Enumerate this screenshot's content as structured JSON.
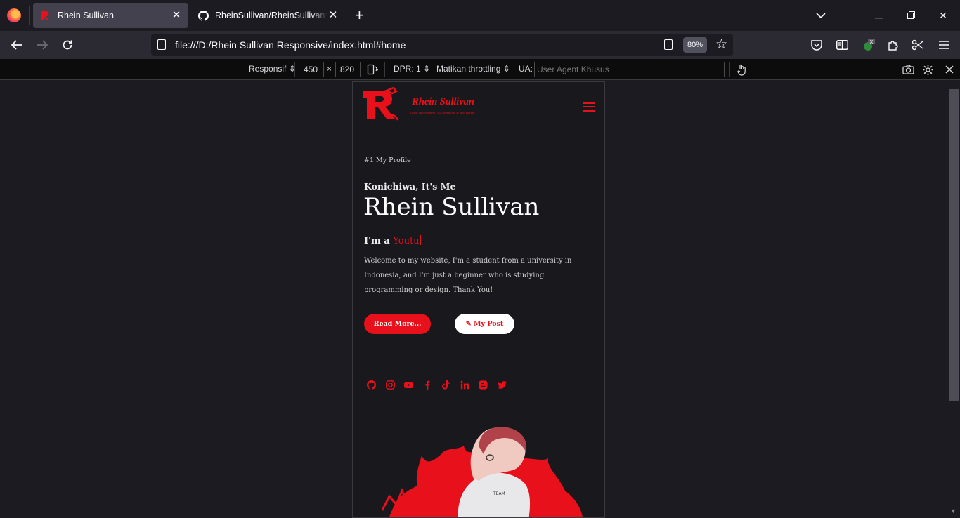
{
  "browser": {
    "tabs": [
      {
        "title": "Rhein Sullivan",
        "active": true
      },
      {
        "title": "RheinSullivan/RheinSullivan: Be",
        "active": false
      }
    ],
    "url": "file:///D:/Rhein Sullivan Responsive/index.html#home",
    "zoom": "80%"
  },
  "responsive_toolbar": {
    "device": "Responsif",
    "width": "450",
    "times": "×",
    "height": "820",
    "dpr": "DPR: 1",
    "throttling": "Matikan throttling",
    "ua_label": "UA:",
    "ua_placeholder": "User Agent Khusus"
  },
  "site": {
    "logo_title": "Rhein Sullivan",
    "logo_subtitle": "Game Development, 3D Animation, & Web Design",
    "profile_tag": "#1 My Profile",
    "greeting": "Konichiwa, It's Me",
    "name": "Rhein Sullivan",
    "role_prefix": "I'm a",
    "role_typed": "Youtu",
    "intro": "Welcome to my website, I'm a student from a university in Indonesia, and I'm just a beginner who is studying programming or design. Thank You!",
    "btn_readmore": "Read More...",
    "btn_post": "My Post",
    "social_icons": [
      "github-icon",
      "instagram-icon",
      "youtube-icon",
      "facebook-icon",
      "tiktok-icon",
      "linkedin-icon",
      "blogger-icon",
      "twitter-icon"
    ],
    "accent_color": "#e8101a"
  }
}
